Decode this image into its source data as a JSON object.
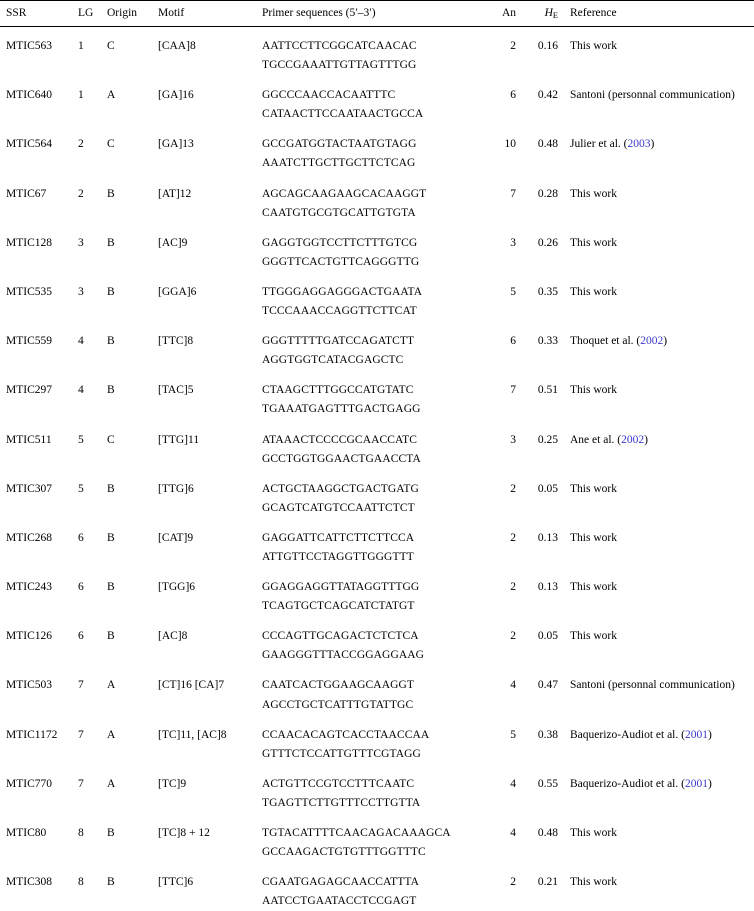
{
  "table": {
    "columns": [
      {
        "key": "ssr",
        "label": "SSR"
      },
      {
        "key": "lg",
        "label": "LG"
      },
      {
        "key": "origin",
        "label": "Origin"
      },
      {
        "key": "motif",
        "label": "Motif"
      },
      {
        "key": "primer",
        "label": "Primer sequences (5′–3′)"
      },
      {
        "key": "an",
        "label": "An"
      },
      {
        "key": "he",
        "label": "HE",
        "label_italic": "H",
        "label_sub": "E"
      },
      {
        "key": "ref",
        "label": "Reference"
      }
    ],
    "link_color": "#3a3acd",
    "rows": [
      {
        "ssr": "MTIC563",
        "lg": "1",
        "origin": "C",
        "motif": "[CAA]8",
        "primer_f": "AATTCCTTCGGCATCAACAC",
        "primer_r": "TGCCGAAATTGTTAGTTTGG",
        "an": "2",
        "he": "0.16",
        "ref_text": "This work",
        "ref_year": ""
      },
      {
        "ssr": "MTIC640",
        "lg": "1",
        "origin": "A",
        "motif": "[GA]16",
        "primer_f": "GGCCCAACCACAATTTC",
        "primer_r": "CATAACTTCCAATAACTGCCA",
        "an": "6",
        "he": "0.42",
        "ref_text": "Santoni (personnal communication)",
        "ref_year": ""
      },
      {
        "ssr": "MTIC564",
        "lg": "2",
        "origin": "C",
        "motif": "[GA]13",
        "primer_f": "GCCGATGGTACTAATGTAGG",
        "primer_r": "AAATCTTGCTTGCTTCTCAG",
        "an": "10",
        "he": "0.48",
        "ref_text": "Julier et al. (",
        "ref_year": "2003",
        "ref_tail": ")"
      },
      {
        "ssr": "MTIC67",
        "lg": "2",
        "origin": "B",
        "motif": "[AT]12",
        "primer_f": "AGCAGCAAGAAGCACAAGGT",
        "primer_r": "CAATGTGCGTGCATTGTGTA",
        "an": "7",
        "he": "0.28",
        "ref_text": "This work",
        "ref_year": ""
      },
      {
        "ssr": "MTIC128",
        "lg": "3",
        "origin": "B",
        "motif": "[AC]9",
        "primer_f": "GAGGTGGTCCTTCTTTGTCG",
        "primer_r": "GGGTTCACTGTTCAGGGTTG",
        "an": "3",
        "he": "0.26",
        "ref_text": "This work",
        "ref_year": ""
      },
      {
        "ssr": "MTIC535",
        "lg": "3",
        "origin": "B",
        "motif": "[GGA]6",
        "primer_f": "TTGGGAGGAGGGACTGAATA",
        "primer_r": "TCCCAAACCAGGTTCTTCAT",
        "an": "5",
        "he": "0.35",
        "ref_text": "This work",
        "ref_year": ""
      },
      {
        "ssr": "MTIC559",
        "lg": "4",
        "origin": "B",
        "motif": "[TTC]8",
        "primer_f": "GGGTTTTTGATCCAGATCTT",
        "primer_r": "AGGTGGTCATACGAGCTC",
        "an": "6",
        "he": "0.33",
        "ref_text": "Thoquet et al. (",
        "ref_year": "2002",
        "ref_tail": ")"
      },
      {
        "ssr": "MTIC297",
        "lg": "4",
        "origin": "B",
        "motif": "[TAC]5",
        "primer_f": "CTAAGCTTTGGCCATGTATC",
        "primer_r": "TGAAATGAGTTTGACTGAGG",
        "an": "7",
        "he": "0.51",
        "ref_text": "This work",
        "ref_year": ""
      },
      {
        "ssr": "MTIC511",
        "lg": "5",
        "origin": "C",
        "motif": "[TTG]11",
        "primer_f": "ATAAACTCCCCGCAACCATC",
        "primer_r": "GCCTGGTGGAACTGAACCTA",
        "an": "3",
        "he": "0.25",
        "ref_text": "Ane et al. (",
        "ref_year": "2002",
        "ref_tail": ")"
      },
      {
        "ssr": "MTIC307",
        "lg": "5",
        "origin": "B",
        "motif": "[TTG]6",
        "primer_f": "ACTGCTAAGGCTGACTGATG",
        "primer_r": "GCAGTCATGTCCAATTCTCT",
        "an": "2",
        "he": "0.05",
        "ref_text": "This work",
        "ref_year": ""
      },
      {
        "ssr": "MTIC268",
        "lg": "6",
        "origin": "B",
        "motif": "[CAT]9",
        "primer_f": "GAGGATTCATTCTTCTTCCA",
        "primer_r": "ATTGTTCCTAGGTTGGGTTT",
        "an": "2",
        "he": "0.13",
        "ref_text": "This work",
        "ref_year": ""
      },
      {
        "ssr": "MTIC243",
        "lg": "6",
        "origin": "B",
        "motif": "[TGG]6",
        "primer_f": "GGAGGAGGTTATAGGTTTGG",
        "primer_r": "TCAGTGCTCAGCATCTATGT",
        "an": "2",
        "he": "0.13",
        "ref_text": "This work",
        "ref_year": ""
      },
      {
        "ssr": "MTIC126",
        "lg": "6",
        "origin": "B",
        "motif": "[AC]8",
        "primer_f": "CCCAGTTGCAGACTCTCTCA",
        "primer_r": "GAAGGGTTTACCGGAGGAAG",
        "an": "2",
        "he": "0.05",
        "ref_text": "This work",
        "ref_year": ""
      },
      {
        "ssr": "MTIC503",
        "lg": "7",
        "origin": "A",
        "motif": "[CT]16 [CA]7",
        "primer_f": "CAATCACTGGAAGCAAGGT",
        "primer_r": "AGCCTGCTCATTTGTATTGC",
        "an": "4",
        "he": "0.47",
        "ref_text": "Santoni (personnal communication)",
        "ref_year": ""
      },
      {
        "ssr": "MTIC1172",
        "lg": "7",
        "origin": "A",
        "motif": "[TC]11, [AC]8",
        "primer_f": "CCAACACAGTCACCTAACCAA",
        "primer_r": "GTTTCTCCATTGTTTCGTAGG",
        "an": "5",
        "he": "0.38",
        "ref_text": "Baquerizo-Audiot et al. (",
        "ref_year": "2001",
        "ref_tail": ")"
      },
      {
        "ssr": "MTIC770",
        "lg": "7",
        "origin": "A",
        "motif": "[TC]9",
        "primer_f": "ACTGTTCCGTCCTTTCAATC",
        "primer_r": "TGAGTTCTTGTTTCCTTGTTA",
        "an": "4",
        "he": "0.55",
        "ref_text": "Baquerizo-Audiot et al. (",
        "ref_year": "2001",
        "ref_tail": ")"
      },
      {
        "ssr": "MTIC80",
        "lg": "8",
        "origin": "B",
        "motif": "[TC]8 + 12",
        "primer_f": "TGTACATTTTCAACAGACAAAGCA",
        "primer_r": "GCCAAGACTGTGTTTGGTTTC",
        "an": "4",
        "he": "0.48",
        "ref_text": "This work",
        "ref_year": ""
      },
      {
        "ssr": "MTIC308",
        "lg": "8",
        "origin": "B",
        "motif": "[TTC]6",
        "primer_f": "CGAATGAGAGCAACCATTTA",
        "primer_r": "AATCCTGAATACCTCCGAGT",
        "an": "2",
        "he": "0.21",
        "ref_text": "This work",
        "ref_year": ""
      }
    ]
  }
}
